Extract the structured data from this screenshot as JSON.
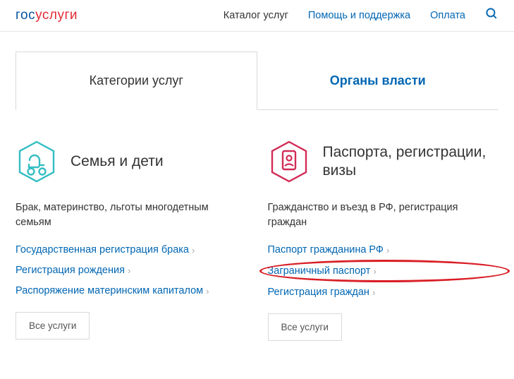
{
  "header": {
    "logo_parts": {
      "p1": "гос",
      "p2": "услуги"
    },
    "nav": {
      "catalog": "Каталог услуг",
      "help": "Помощь и поддержка",
      "payment": "Оплата"
    }
  },
  "tabs": {
    "categories": "Категории услуг",
    "authorities": "Органы власти"
  },
  "categories": {
    "family": {
      "title": "Семья и дети",
      "desc": "Брак, материнство, льготы многодетным семьям",
      "links": [
        "Государственная регистрация брака",
        "Регистрация рождения",
        "Распоряжение материнским капиталом"
      ],
      "all": "Все услуги"
    },
    "passports": {
      "title": "Паспорта, регистрации, визы",
      "desc": "Гражданство и въезд в РФ, регистрация граждан",
      "links": [
        "Паспорт гражданина РФ",
        "Заграничный паспорт",
        "Регистрация граждан"
      ],
      "all": "Все услуги"
    }
  }
}
